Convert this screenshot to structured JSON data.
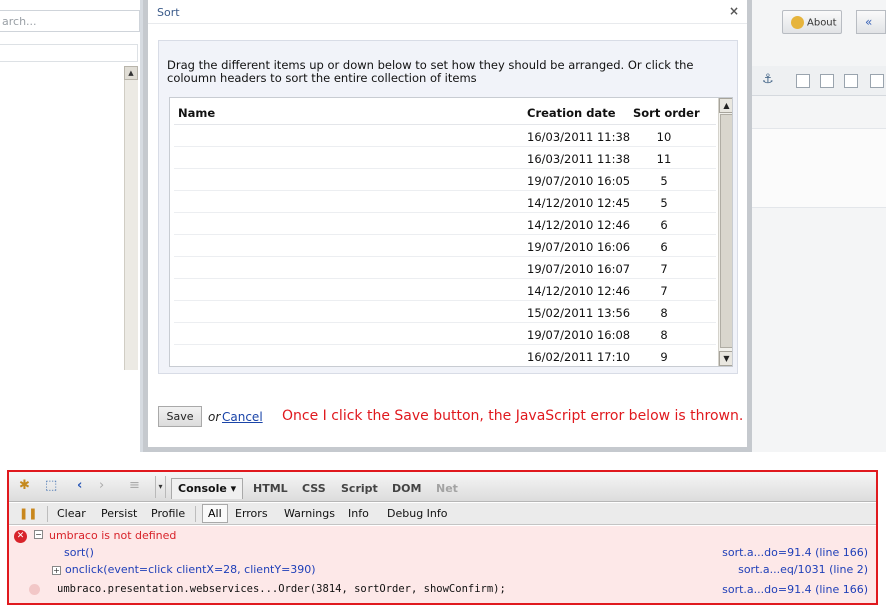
{
  "background": {
    "search_placeholder": "arch...",
    "about_label": "About",
    "nav_icon": "double-chevron-left-icon"
  },
  "modal": {
    "title": "Sort",
    "close_glyph": "×",
    "instructions": "Drag the different items up or down below to set how they should be arranged. Or click the coloumn headers to sort the entire collection of items",
    "columns": [
      "Name",
      "Creation date",
      "Sort order"
    ],
    "rows": [
      {
        "name": "",
        "date": "16/03/2011 11:38",
        "order": "10"
      },
      {
        "name": "",
        "date": "16/03/2011 11:38",
        "order": "11"
      },
      {
        "name": "",
        "date": "19/07/2010 16:05",
        "order": "5"
      },
      {
        "name": "",
        "date": "14/12/2010 12:45",
        "order": "5"
      },
      {
        "name": "",
        "date": "14/12/2010 12:46",
        "order": "6"
      },
      {
        "name": "",
        "date": "19/07/2010 16:06",
        "order": "6"
      },
      {
        "name": "",
        "date": "19/07/2010 16:07",
        "order": "7"
      },
      {
        "name": "",
        "date": "14/12/2010 12:46",
        "order": "7"
      },
      {
        "name": "",
        "date": "15/02/2011 13:56",
        "order": "8"
      },
      {
        "name": "",
        "date": "19/07/2010 16:08",
        "order": "8"
      },
      {
        "name": "",
        "date": "16/02/2011 17:10",
        "order": "9"
      }
    ],
    "save_label": "Save",
    "or_text": "or",
    "cancel_label": "Cancel",
    "annotation": "Once I click the Save button, the JavaScript error below is thrown.",
    "annotation_color": "#e0191e"
  },
  "firebug": {
    "tabs": {
      "console": "Console ▾",
      "html": "HTML",
      "css": "CSS",
      "script": "Script",
      "dom": "DOM",
      "net": "Net"
    },
    "subbar": {
      "clear": "Clear",
      "persist": "Persist",
      "profile": "Profile",
      "all": "All",
      "errors": "Errors",
      "warnings": "Warnings",
      "info": "Info",
      "debug_info": "Debug Info"
    },
    "log": {
      "error_message": "umbraco is not defined",
      "trace_1": "sort()",
      "trace_2": "onclick(event=click clientX=28, clientY=390)",
      "code_line": "umbraco.presentation.webservices...Order(3814, sortOrder, showConfirm);",
      "source_1": "sort.a...do=91.4 (line 166)",
      "source_2": "sort.a...eq/1031 (line 2)",
      "source_3": "sort.a...do=91.4 (line 166)"
    },
    "border_color": "#e0191e",
    "error_bg": "#fde8e8"
  }
}
